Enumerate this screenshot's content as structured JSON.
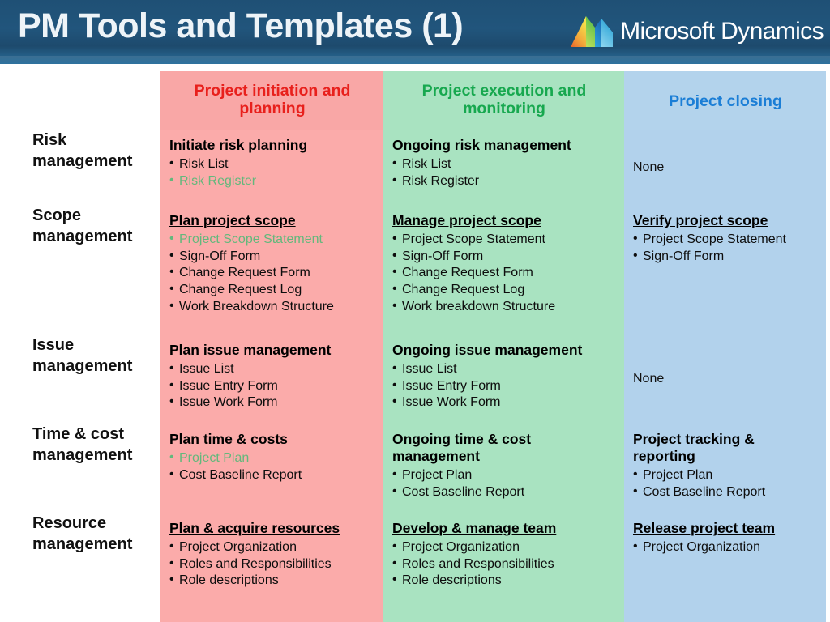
{
  "banner": {
    "title": "PM Tools and Templates (1)",
    "logo_text": "Microsoft Dynamics",
    "logo_icon": "microsoft-dynamics-logo"
  },
  "colors": {
    "banner_bg": "#1f5075",
    "initiation_bg": "#fbabaa",
    "initiation_header_text": "#e8201c",
    "execution_bg": "#a9e3c1",
    "execution_header_text": "#17a84f",
    "closing_bg": "#b2d2ec",
    "closing_header_text": "#1b7ed6",
    "highlight_green_text": "#63b87c"
  },
  "table": {
    "corner_label": "",
    "columns": [
      {
        "key": "initiation",
        "label": "Project initiation and planning"
      },
      {
        "key": "execution",
        "label": "Project execution and monitoring"
      },
      {
        "key": "closing",
        "label": "Project closing"
      }
    ],
    "rows": [
      {
        "label": "Risk management",
        "initiation": {
          "title": "Initiate risk planning",
          "items": [
            {
              "text": "Risk List",
              "highlight": false
            },
            {
              "text": "Risk Register",
              "highlight": true
            }
          ]
        },
        "execution": {
          "title": "Ongoing risk management",
          "items": [
            {
              "text": "Risk List",
              "highlight": false
            },
            {
              "text": "Risk Register",
              "highlight": false
            }
          ]
        },
        "closing": {
          "none_text": "None"
        }
      },
      {
        "label": "Scope management",
        "initiation": {
          "title": "Plan project scope",
          "items": [
            {
              "text": "Project Scope Statement",
              "highlight": true
            },
            {
              "text": "Sign-Off Form",
              "highlight": false
            },
            {
              "text": "Change Request Form",
              "highlight": false
            },
            {
              "text": "Change Request Log",
              "highlight": false
            },
            {
              "text": "Work Breakdown Structure",
              "highlight": false
            }
          ]
        },
        "execution": {
          "title": "Manage project scope",
          "items": [
            {
              "text": "Project Scope Statement",
              "highlight": false
            },
            {
              "text": "Sign-Off Form",
              "highlight": false
            },
            {
              "text": "Change Request Form",
              "highlight": false
            },
            {
              "text": "Change Request Log",
              "highlight": false
            },
            {
              "text": "Work breakdown Structure",
              "highlight": false
            }
          ]
        },
        "closing": {
          "title": "Verify project scope",
          "items": [
            {
              "text": "Project Scope Statement",
              "highlight": false
            },
            {
              "text": "Sign-Off Form",
              "highlight": false
            }
          ]
        }
      },
      {
        "label": "Issue management",
        "initiation": {
          "title": "Plan issue management",
          "items": [
            {
              "text": "Issue List",
              "highlight": false
            },
            {
              "text": "Issue Entry Form",
              "highlight": false
            },
            {
              "text": "Issue Work Form",
              "highlight": false
            }
          ]
        },
        "execution": {
          "title": "Ongoing issue management",
          "items": [
            {
              "text": "Issue List",
              "highlight": false
            },
            {
              "text": "Issue Entry Form",
              "highlight": false
            },
            {
              "text": "Issue Work Form",
              "highlight": false
            }
          ]
        },
        "closing": {
          "none_text": "None"
        }
      },
      {
        "label": "Time & cost management",
        "initiation": {
          "title": "Plan time & costs",
          "items": [
            {
              "text": "Project Plan",
              "highlight": true
            },
            {
              "text": "Cost Baseline Report",
              "highlight": false
            }
          ]
        },
        "execution": {
          "title": "Ongoing time & cost management",
          "items": [
            {
              "text": "Project Plan",
              "highlight": false
            },
            {
              "text": "Cost Baseline Report",
              "highlight": false
            }
          ]
        },
        "closing": {
          "title": "Project tracking & reporting",
          "items": [
            {
              "text": "Project Plan",
              "highlight": false
            },
            {
              "text": "Cost Baseline Report",
              "highlight": false
            }
          ]
        }
      },
      {
        "label": "Resource management",
        "initiation": {
          "title": "Plan & acquire resources",
          "items": [
            {
              "text": "Project Organization",
              "highlight": false
            },
            {
              "text": "Roles and Responsibilities",
              "highlight": false
            },
            {
              "text": "Role descriptions",
              "highlight": false
            }
          ]
        },
        "execution": {
          "title": "Develop & manage team",
          "items": [
            {
              "text": "Project Organization",
              "highlight": false
            },
            {
              "text": "Roles and Responsibilities",
              "highlight": false
            },
            {
              "text": "Role descriptions",
              "highlight": false
            }
          ]
        },
        "closing": {
          "title": "Release project team",
          "items": [
            {
              "text": "Project Organization",
              "highlight": false
            }
          ]
        }
      }
    ]
  }
}
